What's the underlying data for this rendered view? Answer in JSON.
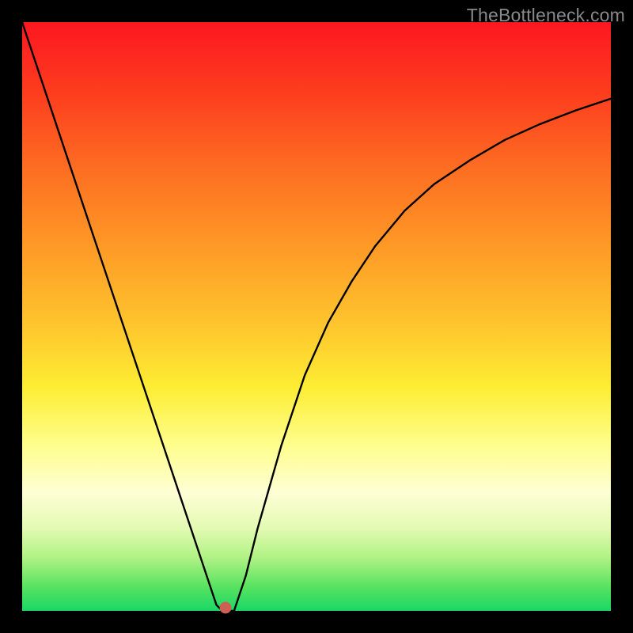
{
  "watermark": "TheBottleneck.com",
  "chart_data": {
    "type": "line",
    "title": "",
    "xlabel": "",
    "ylabel": "",
    "xlim": [
      0,
      100
    ],
    "ylim": [
      0,
      100
    ],
    "series": [
      {
        "name": "curve",
        "x": [
          0,
          4,
          8,
          12,
          16,
          20,
          24,
          28,
          30,
          32,
          33,
          34,
          36,
          38,
          40,
          44,
          48,
          52,
          56,
          60,
          65,
          70,
          76,
          82,
          88,
          94,
          100
        ],
        "y": [
          100,
          88,
          76,
          64,
          52,
          40,
          28,
          16,
          10,
          4,
          1,
          0,
          0,
          6,
          14,
          28,
          40,
          49,
          56,
          62,
          68,
          72.5,
          76.5,
          80,
          82.7,
          85,
          87
        ]
      }
    ],
    "marker": {
      "x": 34.5,
      "y": 0.5
    },
    "gradient_stops": [
      {
        "pos": 0,
        "color": "#fd1721"
      },
      {
        "pos": 12,
        "color": "#fd3d1e"
      },
      {
        "pos": 25,
        "color": "#fd6e22"
      },
      {
        "pos": 38,
        "color": "#fe9926"
      },
      {
        "pos": 52,
        "color": "#fec72e"
      },
      {
        "pos": 62,
        "color": "#fded33"
      },
      {
        "pos": 72,
        "color": "#fefe8e"
      },
      {
        "pos": 80,
        "color": "#fefed5"
      },
      {
        "pos": 86,
        "color": "#e3fab2"
      },
      {
        "pos": 91,
        "color": "#b0f284"
      },
      {
        "pos": 96,
        "color": "#56e260"
      },
      {
        "pos": 100,
        "color": "#1ad866"
      }
    ]
  }
}
